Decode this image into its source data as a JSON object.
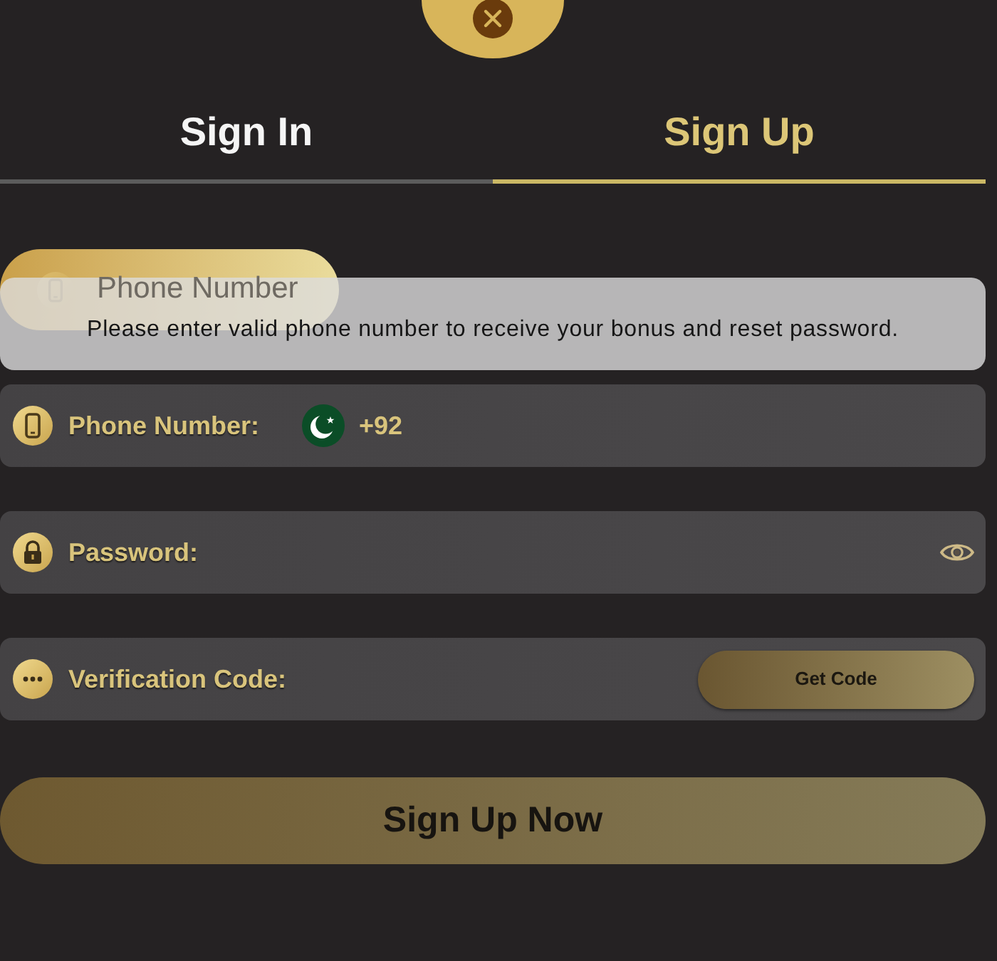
{
  "tabs": [
    {
      "label": "Sign In",
      "selected": false
    },
    {
      "label": "Sign Up",
      "selected": true
    }
  ],
  "floating_label": {
    "text": "Phone Number"
  },
  "tooltip": {
    "text": "Please enter valid phone number to receive your bonus and reset password."
  },
  "fields": [
    {
      "kind": "phone",
      "label": "Phone Number:",
      "country_code": "+92"
    },
    {
      "kind": "password",
      "label": "Password:"
    },
    {
      "kind": "code",
      "label": "Verification Code:",
      "button": "Get Code"
    }
  ],
  "submit": {
    "label": "Sign Up Now"
  }
}
